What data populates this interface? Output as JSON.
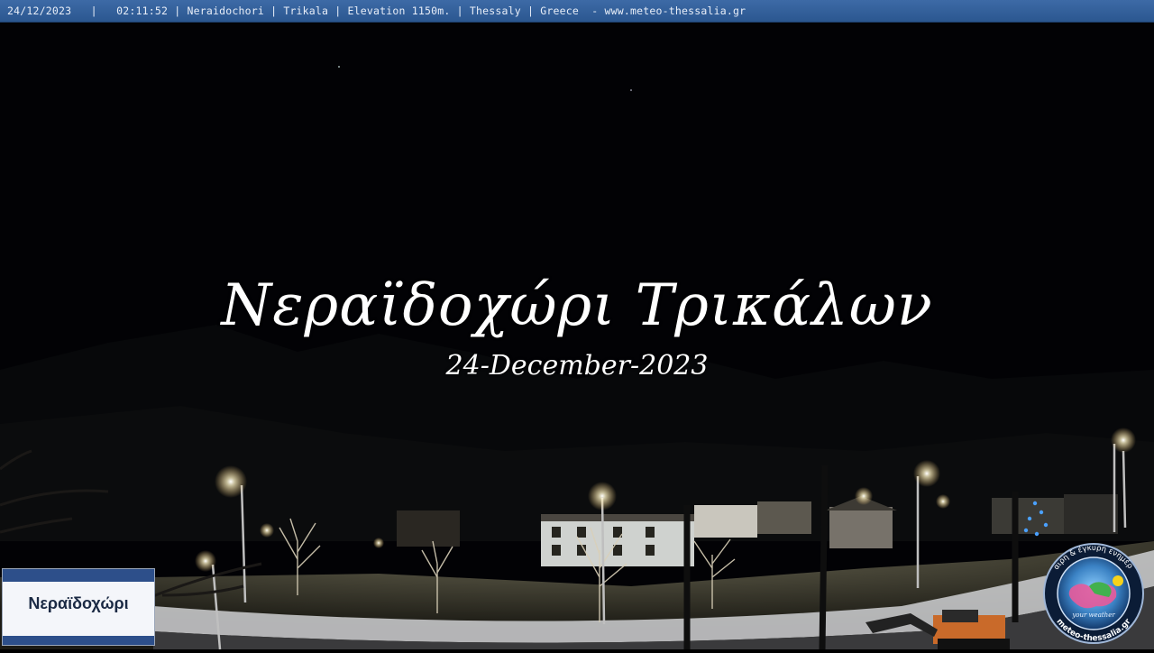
{
  "overlay": {
    "info_bar": "24/12/2023   |   02:11:52 | Neraidochori | Trikala | Elevation 1150m. | Thessaly | Greece  - www.meteo-thessalia.gr",
    "title": "Νεραϊδοχώρι Τρικάλων",
    "date": "24-December-2023"
  },
  "sign": {
    "text": "Νεραϊδοχώρι"
  },
  "logo": {
    "top_text": "Έγκαιρη & έγκυρη ενημέρωση",
    "center_text": "your weather",
    "bottom_text": "meteo-thessalia.gr"
  },
  "colors": {
    "bar": "#2f5b95",
    "sky": "#020205",
    "lamp": "#fff6d8"
  }
}
